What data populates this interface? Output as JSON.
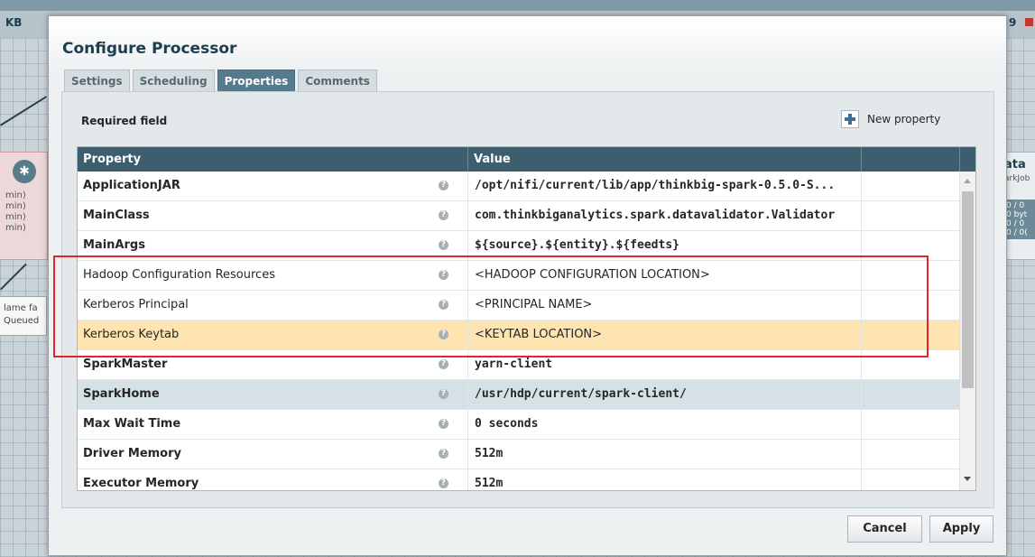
{
  "background": {
    "left_label": "KB",
    "right_label": "9",
    "left_processor_rows": [
      "min)",
      "min)",
      "min)",
      "min)"
    ],
    "left_connection_lines": [
      "lame fa",
      "Queued"
    ],
    "right_processor_title": "ata",
    "right_processor_sub": "arkJob",
    "right_processor_rows": [
      "0 / 0",
      "0 byt",
      "0 / 0",
      "0 / 0("
    ]
  },
  "dialog": {
    "title": "Configure Processor",
    "tabs": [
      {
        "label": "Settings",
        "active": false
      },
      {
        "label": "Scheduling",
        "active": false
      },
      {
        "label": "Properties",
        "active": true
      },
      {
        "label": "Comments",
        "active": false
      }
    ],
    "required_field_label": "Required field",
    "new_property_label": "New property",
    "new_property_icon": "plus-icon",
    "columns": [
      "Property",
      "Value"
    ],
    "properties": [
      {
        "name": "ApplicationJAR",
        "value": "/opt/nifi/current/lib/app/thinkbig-spark-0.5.0-S...",
        "required": true
      },
      {
        "name": "MainClass",
        "value": "com.thinkbiganalytics.spark.datavalidator.Validator",
        "required": true
      },
      {
        "name": "MainArgs",
        "value": "${source}.${entity}.${feedts}",
        "required": true
      },
      {
        "name": "Hadoop Configuration Resources",
        "value": "<HADOOP CONFIGURATION LOCATION>",
        "required": false
      },
      {
        "name": "Kerberos Principal",
        "value": "<PRINCIPAL NAME>",
        "required": false
      },
      {
        "name": "Kerberos Keytab",
        "value": "<KEYTAB LOCATION>",
        "required": false,
        "state": "selected"
      },
      {
        "name": "SparkMaster",
        "value": "yarn-client",
        "required": true
      },
      {
        "name": "SparkHome",
        "value": "/usr/hdp/current/spark-client/",
        "required": true,
        "state": "hover"
      },
      {
        "name": "Max Wait Time",
        "value": "0 seconds",
        "required": true
      },
      {
        "name": "Driver Memory",
        "value": "512m",
        "required": true
      },
      {
        "name": "Executor Memory",
        "value": "512m",
        "required": true
      }
    ],
    "help_icon_glyph": "?",
    "buttons": {
      "cancel": "Cancel",
      "apply": "Apply"
    },
    "colors": {
      "header": "#3d5e6f",
      "selected_row": "#fde4b0",
      "hover_row": "#d6e1e6",
      "highlight": "#e5232a",
      "active_tab": "#547a8c"
    }
  }
}
